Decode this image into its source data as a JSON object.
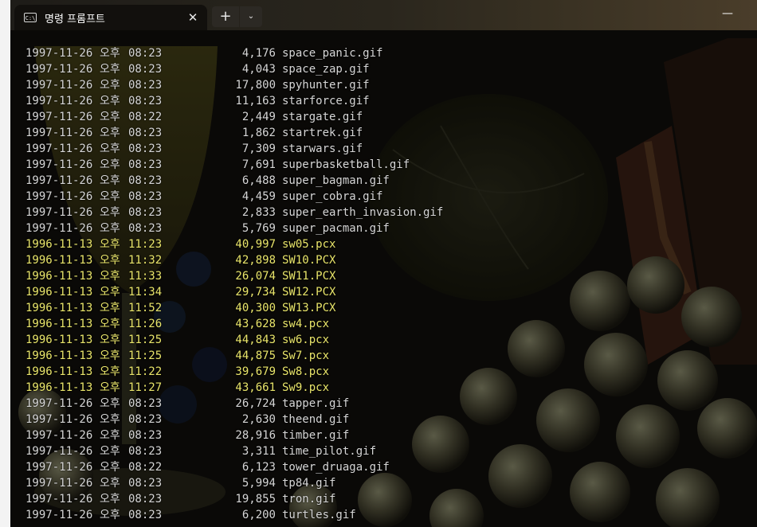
{
  "window": {
    "tab_title": "명령 프롬프트",
    "tab_icon_text": "C:\\",
    "close_glyph": "✕",
    "new_tab_glyph": "+",
    "dropdown_glyph": "⌄",
    "minimize_glyph": "—"
  },
  "colors": {
    "normal_text": "#d6d6d6",
    "highlight_text": "#e9e56a",
    "terminal_bg": "#0f0d0a"
  },
  "listing": [
    {
      "date": "1997-11-26",
      "ampm": "오후",
      "time": "08:23",
      "size": "4,176",
      "name": "space_panic.gif",
      "highlight": false
    },
    {
      "date": "1997-11-26",
      "ampm": "오후",
      "time": "08:23",
      "size": "4,043",
      "name": "space_zap.gif",
      "highlight": false
    },
    {
      "date": "1997-11-26",
      "ampm": "오후",
      "time": "08:23",
      "size": "17,800",
      "name": "spyhunter.gif",
      "highlight": false
    },
    {
      "date": "1997-11-26",
      "ampm": "오후",
      "time": "08:23",
      "size": "11,163",
      "name": "starforce.gif",
      "highlight": false
    },
    {
      "date": "1997-11-26",
      "ampm": "오후",
      "time": "08:22",
      "size": "2,449",
      "name": "stargate.gif",
      "highlight": false
    },
    {
      "date": "1997-11-26",
      "ampm": "오후",
      "time": "08:23",
      "size": "1,862",
      "name": "startrek.gif",
      "highlight": false
    },
    {
      "date": "1997-11-26",
      "ampm": "오후",
      "time": "08:23",
      "size": "7,309",
      "name": "starwars.gif",
      "highlight": false
    },
    {
      "date": "1997-11-26",
      "ampm": "오후",
      "time": "08:23",
      "size": "7,691",
      "name": "superbasketball.gif",
      "highlight": false
    },
    {
      "date": "1997-11-26",
      "ampm": "오후",
      "time": "08:23",
      "size": "6,488",
      "name": "super_bagman.gif",
      "highlight": false
    },
    {
      "date": "1997-11-26",
      "ampm": "오후",
      "time": "08:23",
      "size": "4,459",
      "name": "super_cobra.gif",
      "highlight": false
    },
    {
      "date": "1997-11-26",
      "ampm": "오후",
      "time": "08:23",
      "size": "2,833",
      "name": "super_earth_invasion.gif",
      "highlight": false
    },
    {
      "date": "1997-11-26",
      "ampm": "오후",
      "time": "08:23",
      "size": "5,769",
      "name": "super_pacman.gif",
      "highlight": false
    },
    {
      "date": "1996-11-13",
      "ampm": "오후",
      "time": "11:23",
      "size": "40,997",
      "name": "sw05.pcx",
      "highlight": true
    },
    {
      "date": "1996-11-13",
      "ampm": "오후",
      "time": "11:32",
      "size": "42,898",
      "name": "SW10.PCX",
      "highlight": true
    },
    {
      "date": "1996-11-13",
      "ampm": "오후",
      "time": "11:33",
      "size": "26,074",
      "name": "SW11.PCX",
      "highlight": true
    },
    {
      "date": "1996-11-13",
      "ampm": "오후",
      "time": "11:34",
      "size": "29,734",
      "name": "SW12.PCX",
      "highlight": true
    },
    {
      "date": "1996-11-13",
      "ampm": "오후",
      "time": "11:52",
      "size": "40,300",
      "name": "SW13.PCX",
      "highlight": true
    },
    {
      "date": "1996-11-13",
      "ampm": "오후",
      "time": "11:26",
      "size": "43,628",
      "name": "sw4.pcx",
      "highlight": true
    },
    {
      "date": "1996-11-13",
      "ampm": "오후",
      "time": "11:25",
      "size": "44,843",
      "name": "sw6.pcx",
      "highlight": true
    },
    {
      "date": "1996-11-13",
      "ampm": "오후",
      "time": "11:25",
      "size": "44,875",
      "name": "Sw7.pcx",
      "highlight": true
    },
    {
      "date": "1996-11-13",
      "ampm": "오후",
      "time": "11:22",
      "size": "39,679",
      "name": "Sw8.pcx",
      "highlight": true
    },
    {
      "date": "1996-11-13",
      "ampm": "오후",
      "time": "11:27",
      "size": "43,661",
      "name": "Sw9.pcx",
      "highlight": true
    },
    {
      "date": "1997-11-26",
      "ampm": "오후",
      "time": "08:23",
      "size": "26,724",
      "name": "tapper.gif",
      "highlight": false
    },
    {
      "date": "1997-11-26",
      "ampm": "오후",
      "time": "08:23",
      "size": "2,630",
      "name": "theend.gif",
      "highlight": false
    },
    {
      "date": "1997-11-26",
      "ampm": "오후",
      "time": "08:23",
      "size": "28,916",
      "name": "timber.gif",
      "highlight": false
    },
    {
      "date": "1997-11-26",
      "ampm": "오후",
      "time": "08:23",
      "size": "3,311",
      "name": "time_pilot.gif",
      "highlight": false
    },
    {
      "date": "1997-11-26",
      "ampm": "오후",
      "time": "08:22",
      "size": "6,123",
      "name": "tower_druaga.gif",
      "highlight": false
    },
    {
      "date": "1997-11-26",
      "ampm": "오후",
      "time": "08:23",
      "size": "5,994",
      "name": "tp84.gif",
      "highlight": false
    },
    {
      "date": "1997-11-26",
      "ampm": "오후",
      "time": "08:23",
      "size": "19,855",
      "name": "tron.gif",
      "highlight": false
    },
    {
      "date": "1997-11-26",
      "ampm": "오후",
      "time": "08:23",
      "size": "6,200",
      "name": "turtles.gif",
      "highlight": false
    }
  ]
}
